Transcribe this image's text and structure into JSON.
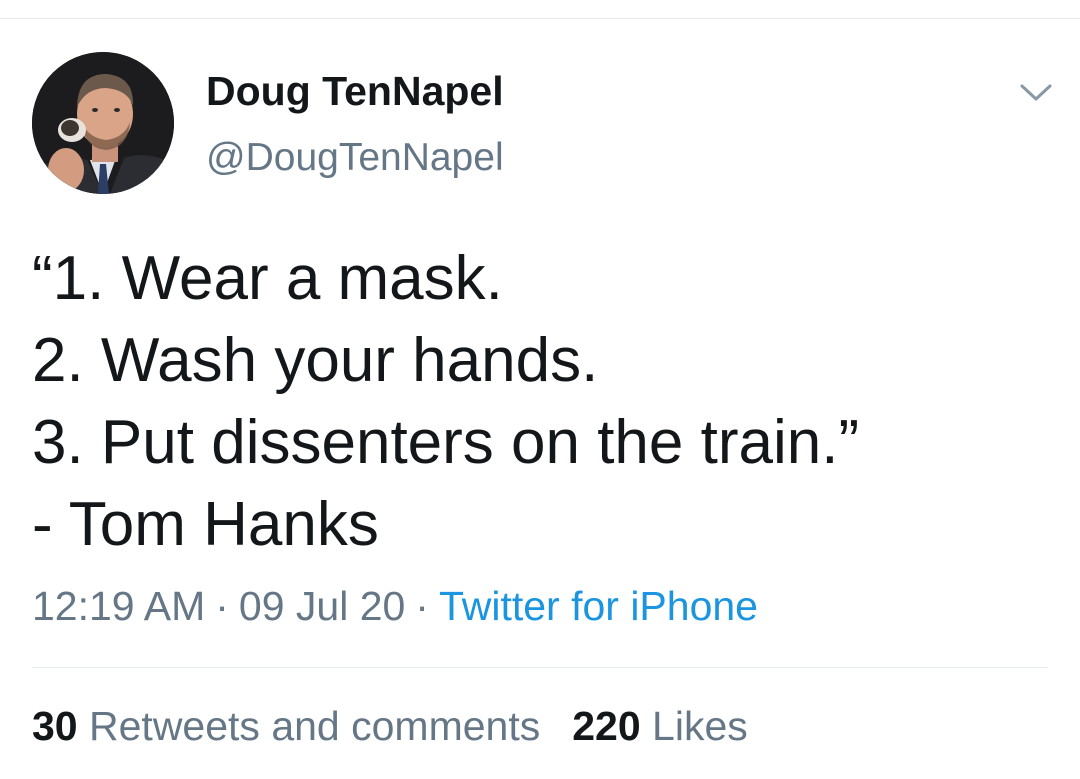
{
  "author": {
    "display_name": "Doug TenNapel",
    "handle": "@DougTenNapel",
    "avatar_icon": "profile-photo"
  },
  "menu": {
    "icon": "chevron-down-icon"
  },
  "tweet": {
    "lines": [
      "“1. Wear a mask.",
      "2. Wash your hands.",
      "3. Put dissenters on the train.”",
      "- Tom Hanks"
    ]
  },
  "meta": {
    "time": "12:19 AM",
    "date": "09 Jul 20",
    "source": "Twitter for iPhone",
    "separator": "·"
  },
  "stats": {
    "retweets_count": "30",
    "retweets_label": "Retweets and comments",
    "likes_count": "220",
    "likes_label": "Likes"
  },
  "colors": {
    "text_primary": "#14171a",
    "text_secondary": "#657786",
    "link": "#1b95e0",
    "divider": "#e6ecf0"
  }
}
